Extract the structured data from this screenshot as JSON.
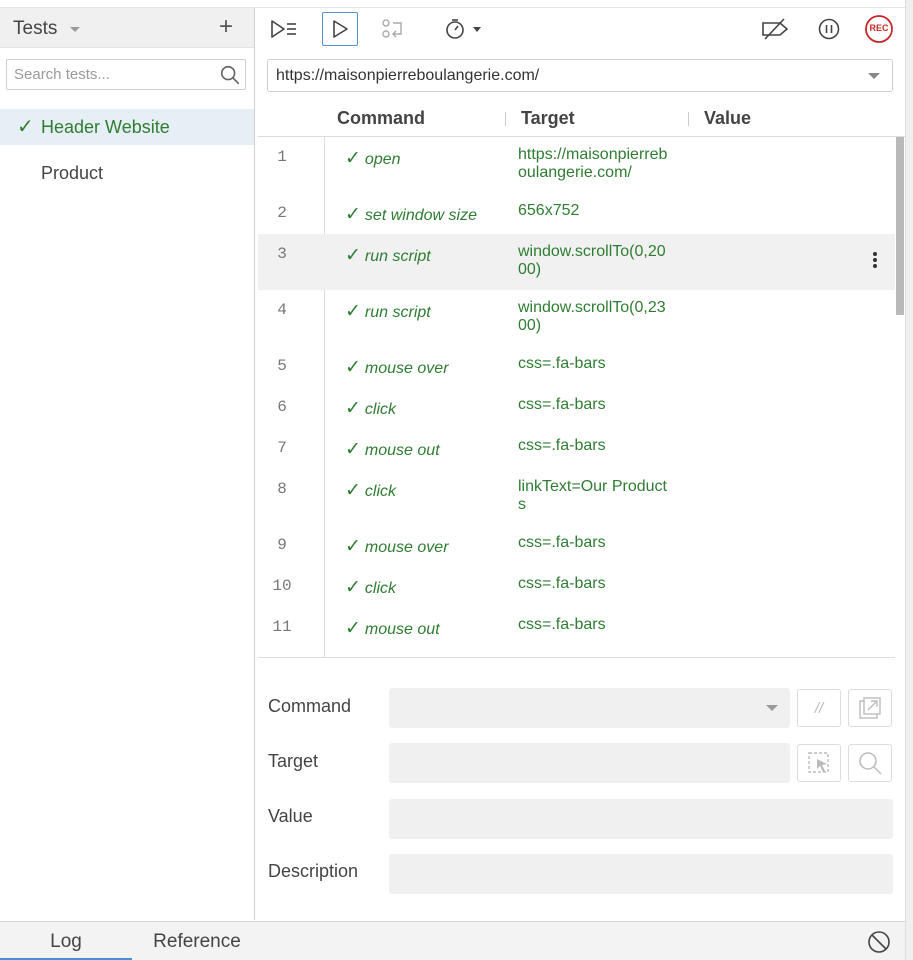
{
  "sidebar": {
    "title": "Tests",
    "add_label": "+",
    "search_placeholder": "Search tests...",
    "tests": [
      {
        "label": "Header Website",
        "selected": true,
        "check": "✓"
      },
      {
        "label": "Product",
        "selected": false
      }
    ]
  },
  "toolbar": {
    "icons": [
      "run-all-icon",
      "run-current-icon",
      "step-icon",
      "speed-icon",
      "disable-breakpoints-icon",
      "pause-icon",
      "record-icon"
    ],
    "record_label": "REC"
  },
  "url": {
    "value": "https://maisonpierreboulangerie.com/"
  },
  "table": {
    "headers": {
      "command": "Command",
      "target": "Target",
      "value": "Value"
    },
    "check": "✓",
    "rows": [
      {
        "num": "1",
        "command": "open",
        "target": "https://maisonpierreboulangerie.com/"
      },
      {
        "num": "2",
        "command": "set window size",
        "target": "656x752"
      },
      {
        "num": "3",
        "command": "run script",
        "target": "window.scrollTo(0,2000)"
      },
      {
        "num": "4",
        "command": "run script",
        "target": "window.scrollTo(0,2300)"
      },
      {
        "num": "5",
        "command": "mouse over",
        "target": "css=.fa-bars"
      },
      {
        "num": "6",
        "command": "click",
        "target": "css=.fa-bars"
      },
      {
        "num": "7",
        "command": "mouse out",
        "target": "css=.fa-bars"
      },
      {
        "num": "8",
        "command": "click",
        "target": "linkText=Our Products"
      },
      {
        "num": "9",
        "command": "mouse over",
        "target": "css=.fa-bars"
      },
      {
        "num": "10",
        "command": "click",
        "target": "css=.fa-bars"
      },
      {
        "num": "11",
        "command": "mouse out",
        "target": "css=.fa-bars"
      }
    ]
  },
  "editor": {
    "command_label": "Command",
    "target_label": "Target",
    "value_label": "Value",
    "description_label": "Description",
    "comment_button": "//"
  },
  "bottom": {
    "tabs": [
      "Log",
      "Reference"
    ]
  },
  "colors": {
    "success": "#2f7d32",
    "accent": "#4a90d9",
    "record": "#c62828"
  }
}
